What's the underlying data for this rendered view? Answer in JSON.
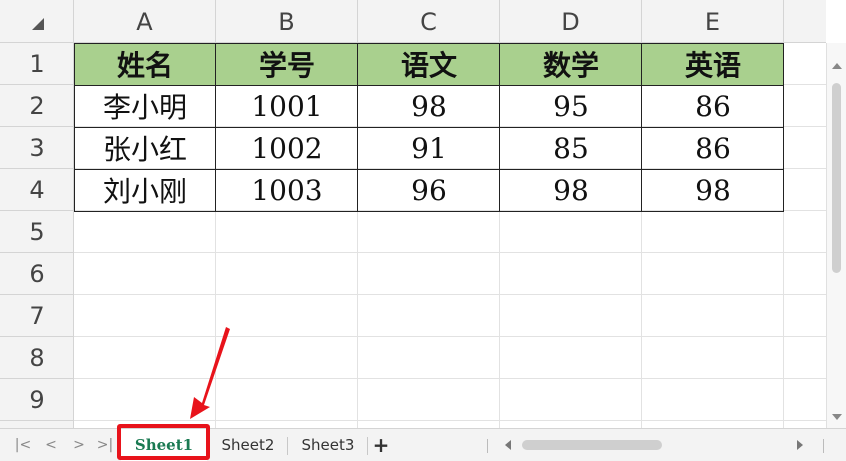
{
  "columns": [
    "A",
    "B",
    "C",
    "D",
    "E"
  ],
  "rows": [
    "1",
    "2",
    "3",
    "4",
    "5",
    "6",
    "7",
    "8",
    "9"
  ],
  "table": {
    "header": [
      "姓名",
      "学号",
      "语文",
      "数学",
      "英语"
    ],
    "records": [
      [
        "李小明",
        "1001",
        "98",
        "95",
        "86"
      ],
      [
        "张小红",
        "1002",
        "91",
        "85",
        "86"
      ],
      [
        "刘小刚",
        "1003",
        "96",
        "98",
        "98"
      ]
    ]
  },
  "tabs": {
    "nav": [
      "K",
      "<",
      ">",
      "K"
    ],
    "sheets": [
      "Sheet1",
      "Sheet2",
      "Sheet3"
    ],
    "active": "Sheet1",
    "add_label": "+"
  },
  "colors": {
    "header_fill": "#a9d08e",
    "annotation": "#e8131b",
    "active_tab_text": "#1a7a52"
  }
}
